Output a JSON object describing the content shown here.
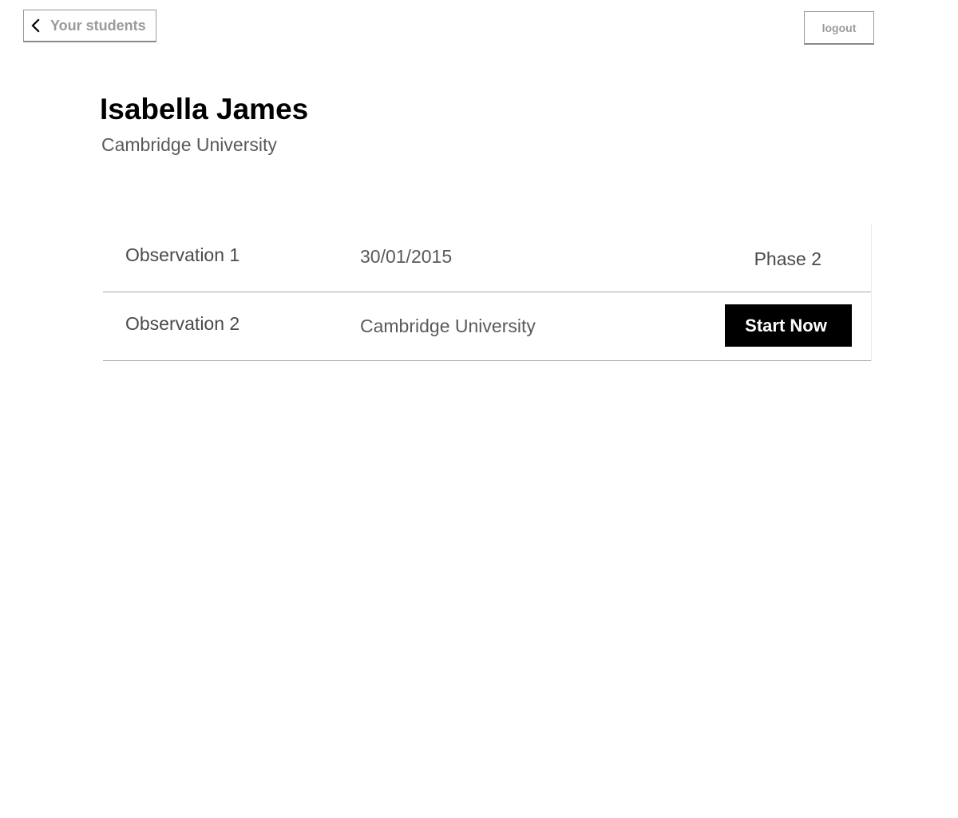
{
  "nav": {
    "back_label": "Your students",
    "back_icon": "chevron-left-icon",
    "logout_label": "logout"
  },
  "student": {
    "name": "Isabella James",
    "school": "Cambridge University"
  },
  "observations": [
    {
      "name": "Observation 1",
      "detail": "30/01/2015",
      "status": "Phase 2"
    },
    {
      "name": "Observation 2",
      "detail": "Cambridge University",
      "action_label": "Start Now"
    }
  ],
  "colors": {
    "primary_button_bg": "#000000",
    "primary_button_text": "#ffffff",
    "muted_text": "#9a9a9a"
  }
}
